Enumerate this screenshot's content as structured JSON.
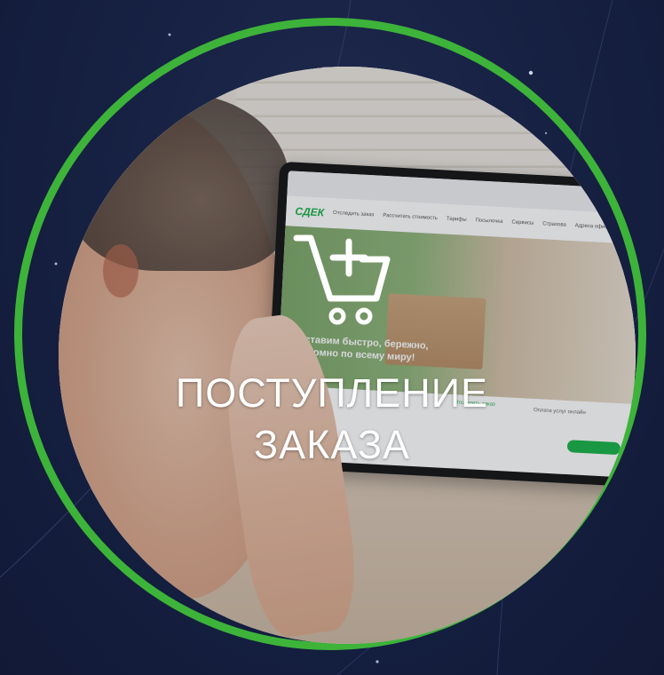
{
  "colors": {
    "background": "#141d3a",
    "ring": "#3db33a",
    "text": "#ffffff",
    "brand_green": "#1ab248"
  },
  "icon": {
    "name": "cart-plus-icon"
  },
  "title": {
    "line1": "ПОСТУПЛЕНИЕ",
    "line2": "ЗАКАЗА"
  },
  "screen": {
    "logo": "СДЕК",
    "nav_items": [
      "Отследить заказ",
      "Рассчитать стоимость",
      "Тарифы",
      "Посылочка",
      "Сервисы",
      "Страхова",
      "Адреса офисов"
    ],
    "hero_text": "Доставим быстро, бережно, экономно по всему миру!",
    "track_link": "Отследить заказ",
    "payment_link": "Оплата услуг онлайн"
  }
}
